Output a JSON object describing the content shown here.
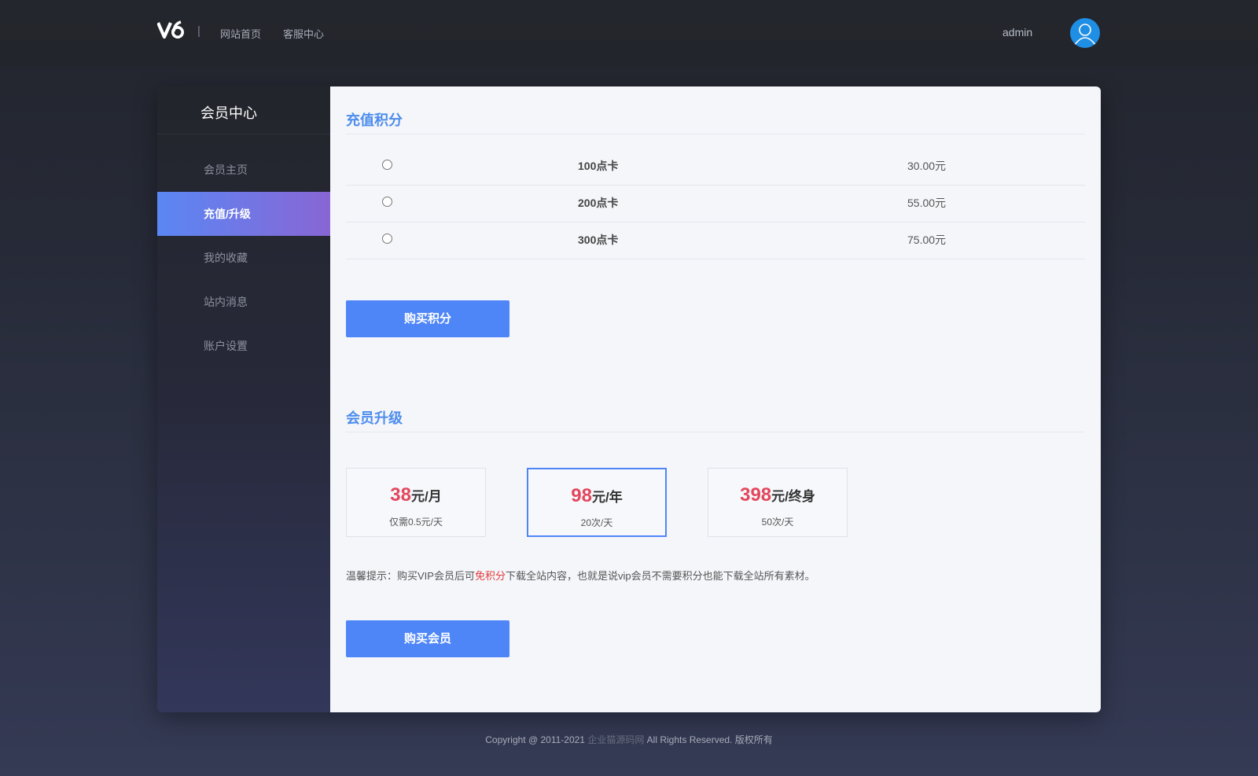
{
  "header": {
    "logo_text": "V6",
    "separator": "|",
    "nav": [
      "网站首页",
      "客服中心"
    ],
    "username": "admin"
  },
  "sidebar": {
    "title": "会员中心",
    "items": [
      {
        "label": "会员主页",
        "active": false
      },
      {
        "label": "充值/升级",
        "active": true
      },
      {
        "label": "我的收藏",
        "active": false
      },
      {
        "label": "站内消息",
        "active": false
      },
      {
        "label": "账户设置",
        "active": false
      }
    ]
  },
  "points": {
    "title": "充值积分",
    "options": [
      {
        "name": "100点卡",
        "price": "30.00元",
        "selected": false
      },
      {
        "name": "200点卡",
        "price": "55.00元",
        "selected": false
      },
      {
        "name": "300点卡",
        "price": "75.00元",
        "selected": false
      }
    ],
    "buy_label": "购买积分"
  },
  "membership": {
    "title": "会员升级",
    "plans": [
      {
        "amount": "38",
        "unit": "元/月",
        "note": "仅需0.5元/天",
        "selected": false
      },
      {
        "amount": "98",
        "unit": "元/年",
        "note": "20次/天",
        "selected": true
      },
      {
        "amount": "398",
        "unit": "元/终身",
        "note": "50次/天",
        "selected": false
      }
    ],
    "tip_prefix": "温馨提示：购买VIP会员后可",
    "tip_highlight": "免积分",
    "tip_suffix": "下载全站内容，也就是说vip会员不需要积分也能下载全站所有素材。",
    "buy_label": "购买会员"
  },
  "footer": {
    "copyright": "Copyright @ 2011-2021",
    "site_name": "企业猫源码网",
    "rights": "All Rights Reserved. 版权所有"
  },
  "colors": {
    "accent": "#4f86f7",
    "price_red": "#e2475d",
    "highlight_red": "#e23b3b",
    "active_gradient_start": "#5a87f4",
    "active_gradient_end": "#8866d4"
  }
}
